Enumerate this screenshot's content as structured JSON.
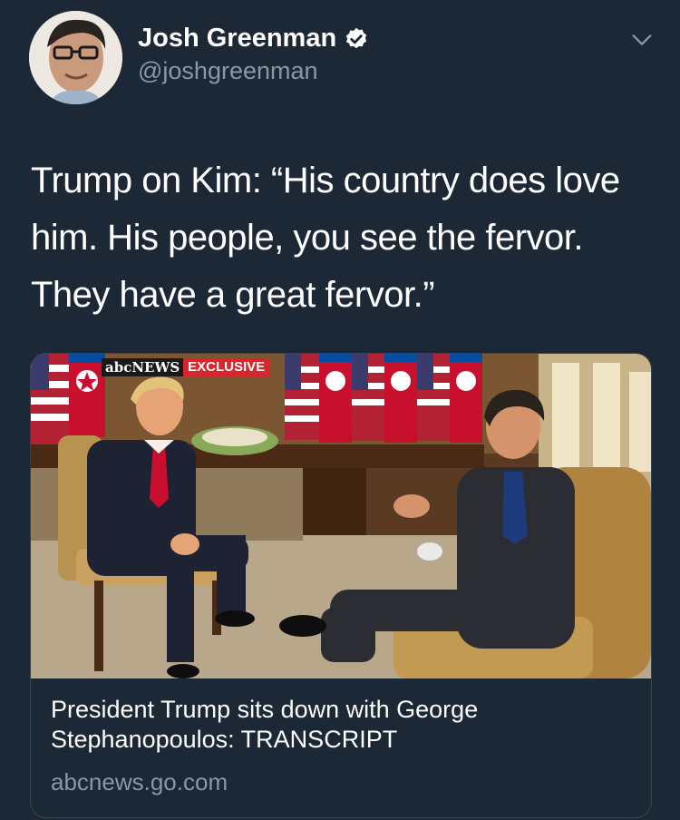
{
  "author": {
    "name": "Josh Greenman",
    "handle": "@joshgreenman"
  },
  "tweet": {
    "text": "Trump on Kim: “His country does love him. His people, you see the fervor. They have a great fervor.”"
  },
  "card": {
    "badge_network": "abcNEWS",
    "badge_label": "EXCLUSIVE",
    "title": "President Trump sits down with George Stephanopoulos: TRANSCRIPT",
    "domain": "abcnews.go.com"
  },
  "icons": {
    "verified": "verified-badge-icon",
    "menu": "chevron-down-icon"
  },
  "colors": {
    "background": "#1c2836",
    "secondary_text": "#8899a6",
    "border": "#38444d",
    "exclusive_red": "#d8262e"
  }
}
